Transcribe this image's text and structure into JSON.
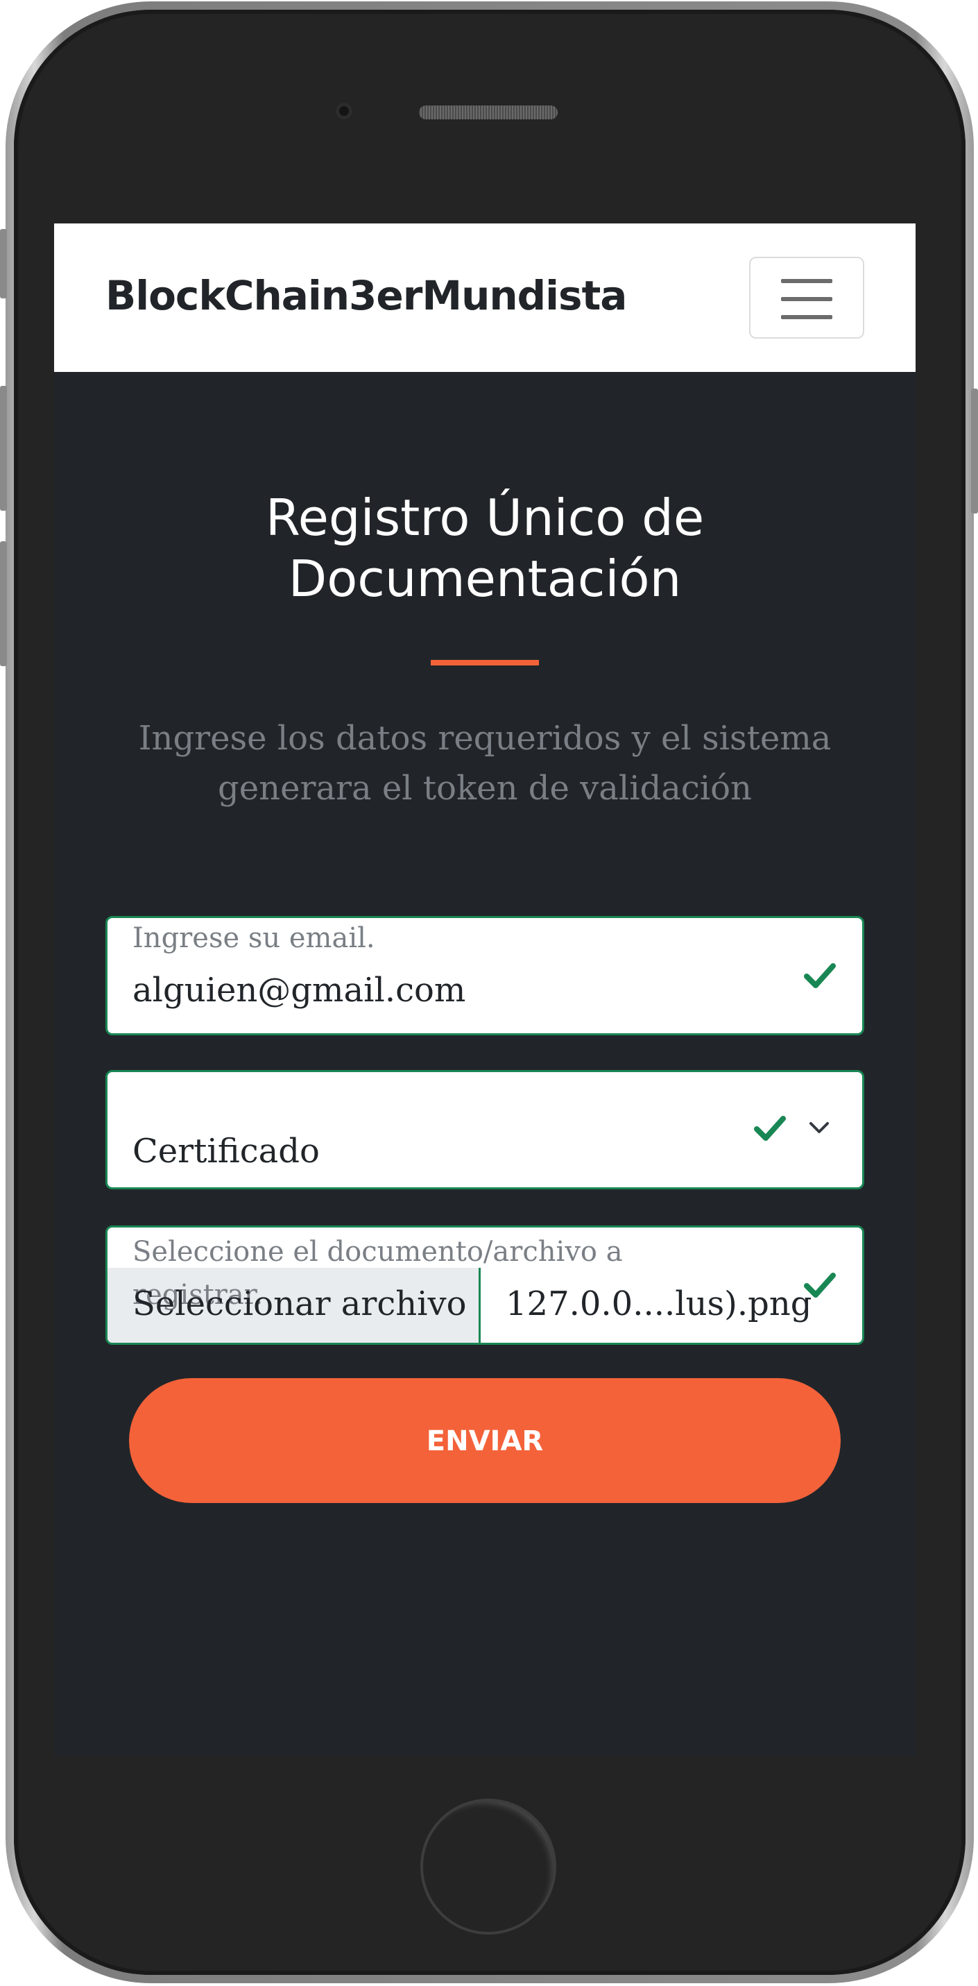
{
  "navbar": {
    "brand": "BlockChain3erMundista"
  },
  "header": {
    "title_line1": "Registro Único de",
    "title_line2": "Documentación",
    "subtitle_line1": "Ingrese los datos requeridos y el sistema",
    "subtitle_line2": "generara el token de validación"
  },
  "form": {
    "email": {
      "label": "Ingrese su email.",
      "value": "alguien@gmail.com",
      "status": "valid"
    },
    "doc_type": {
      "selected": "Certificado",
      "status": "valid"
    },
    "file": {
      "label": "Seleccione el documento/archivo a registrar.",
      "button_label": "Seleccionar archivo",
      "file_name": "127.0.0....lus).png",
      "status": "valid"
    },
    "submit_label": "ENVIAR"
  },
  "colors": {
    "accent": "#f4623a",
    "valid": "#198754",
    "screen_bg": "#212529"
  },
  "icons": {
    "menu": "hamburger-icon",
    "valid": "check-icon",
    "select": "chevron-down-icon"
  }
}
